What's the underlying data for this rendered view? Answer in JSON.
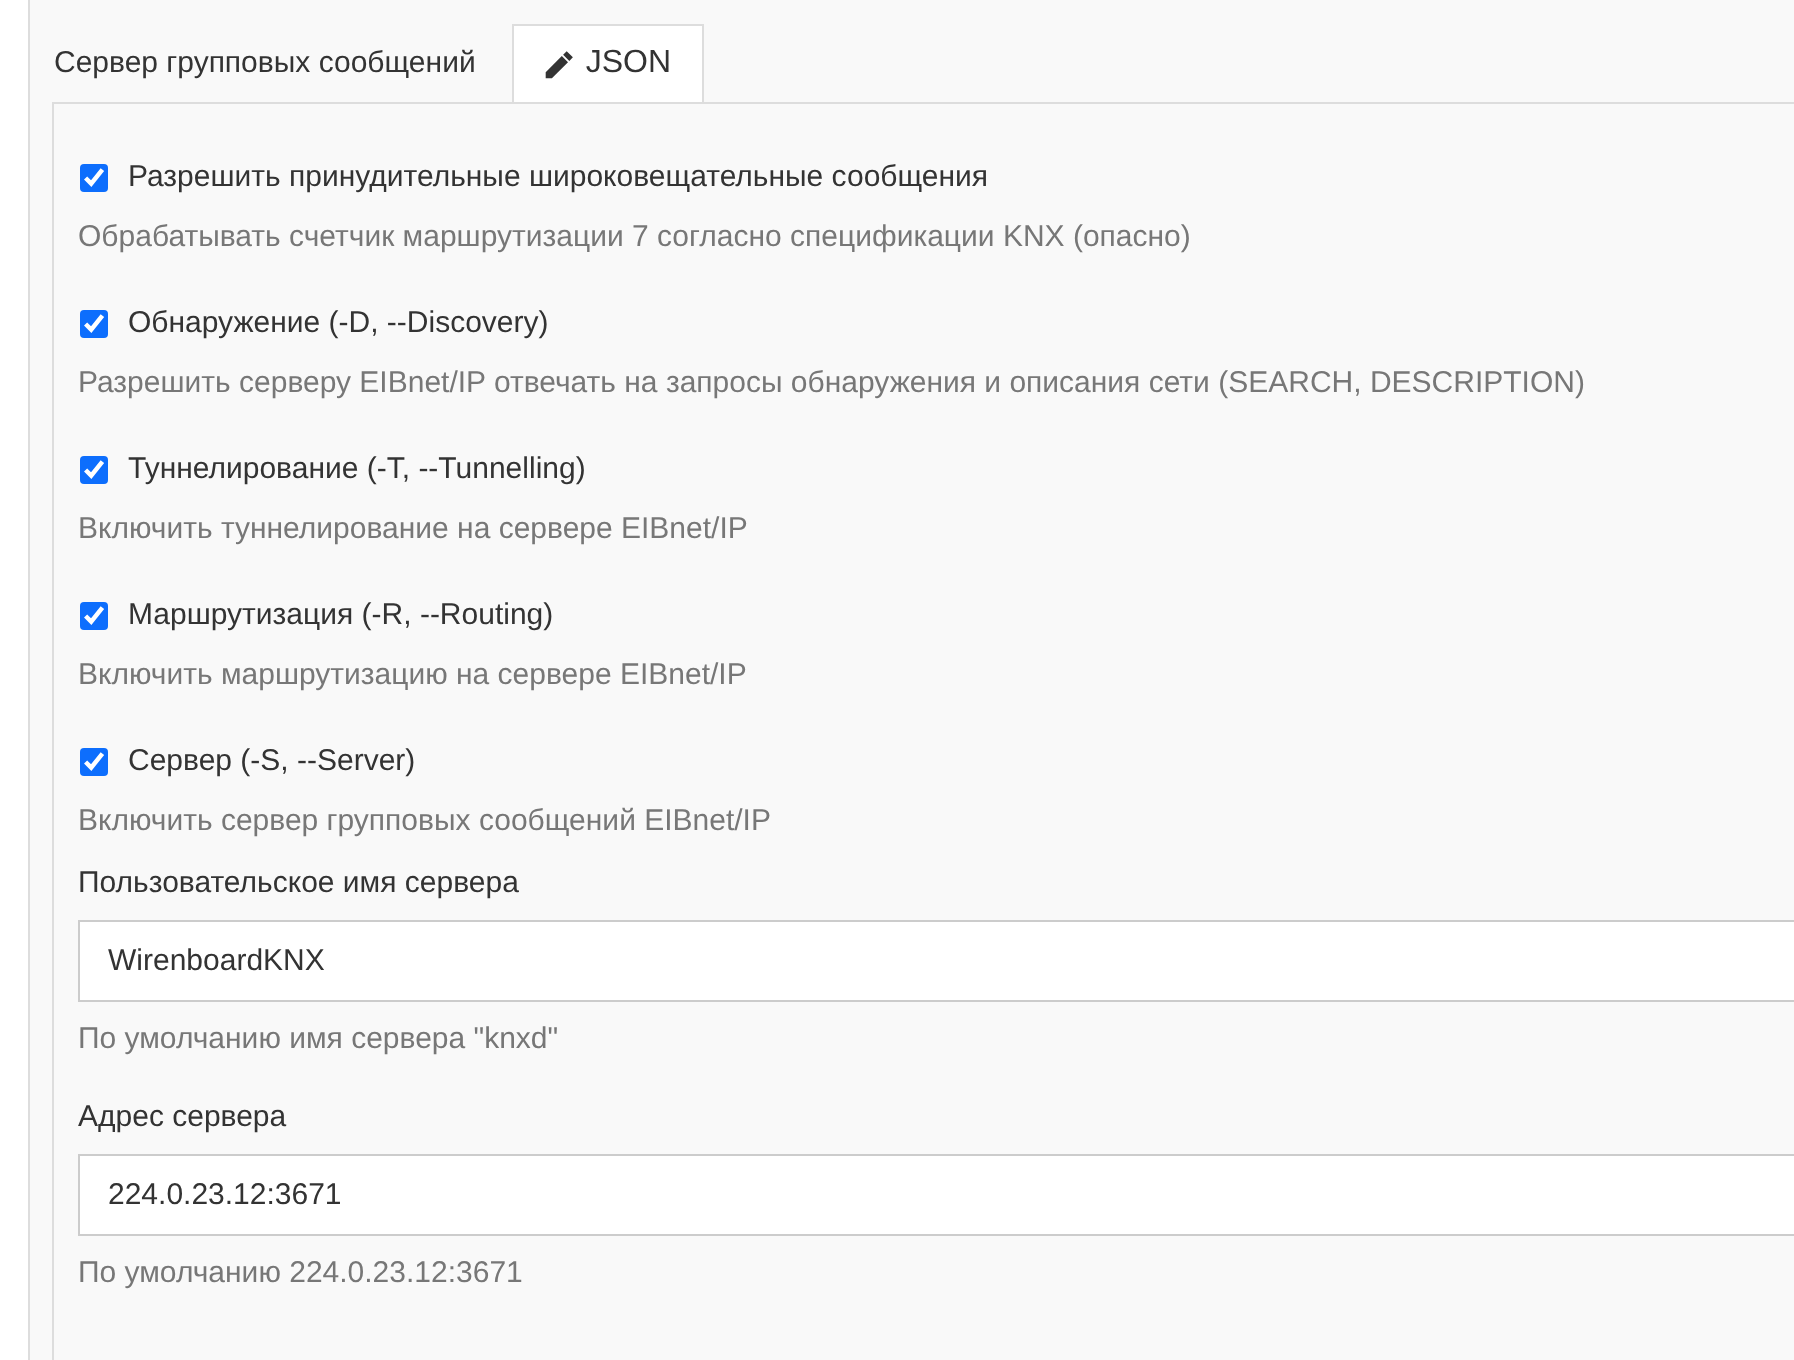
{
  "section": {
    "title": "Сервер групповых сообщений",
    "json_button": "JSON"
  },
  "options": [
    {
      "label": "Разрешить принудительные широковещательные сообщения",
      "checked": true,
      "description": "Обрабатывать счетчик маршрутизации 7 согласно спецификации KNX (опасно)"
    },
    {
      "label": "Обнаружение (-D, --Discovery)",
      "checked": true,
      "description": "Разрешить серверу EIBnet/IP отвечать на запросы обнаружения и описания сети (SEARCH, DESCRIPTION)"
    },
    {
      "label": "Туннелирование (-T, --Tunnelling)",
      "checked": true,
      "description": "Включить туннелирование на сервере EIBnet/IP"
    },
    {
      "label": "Маршрутизация (-R, --Routing)",
      "checked": true,
      "description": "Включить маршрутизацию на сервере EIBnet/IP"
    },
    {
      "label": "Сервер (-S, --Server)",
      "checked": true,
      "description": "Включить сервер групповых сообщений EIBnet/IP"
    }
  ],
  "fields": [
    {
      "label": "Пользовательское имя сервера",
      "value": "WirenboardKNX",
      "help": "По умолчанию имя сервера \"knxd\""
    },
    {
      "label": "Адрес сервера",
      "value": "224.0.23.12:3671",
      "help": "По умолчанию 224.0.23.12:3671"
    }
  ]
}
